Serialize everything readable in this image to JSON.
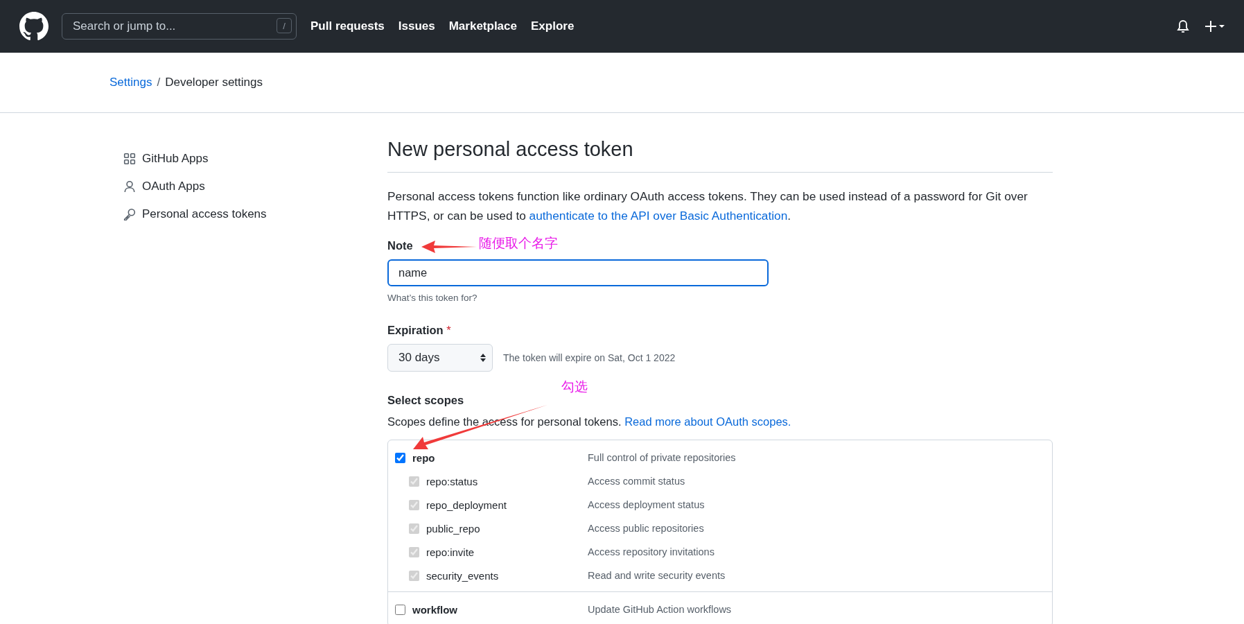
{
  "header": {
    "search": {
      "placeholder": "Search or jump to...",
      "key": "/"
    },
    "nav": [
      "Pull requests",
      "Issues",
      "Marketplace",
      "Explore"
    ]
  },
  "breadcrumb": {
    "items": [
      {
        "label": "Settings",
        "kind": "link"
      },
      {
        "label": "Developer settings",
        "kind": "current"
      }
    ],
    "separator": "/"
  },
  "sidebar": {
    "items": [
      {
        "label": "GitHub Apps"
      },
      {
        "label": "OAuth Apps"
      },
      {
        "label": "Personal access tokens"
      }
    ]
  },
  "main": {
    "title": "New personal access token",
    "intro": {
      "text": "Personal access tokens function like ordinary OAuth access tokens. They can be used instead of a password for Git over HTTPS, or can be used to ",
      "link": "authenticate to the API over Basic Authentication",
      "end": "."
    },
    "note": {
      "label": "Note",
      "value": "name",
      "hint": "What’s this token for?"
    },
    "expiration": {
      "label": "Expiration",
      "required": "*",
      "value": "30 days",
      "info": "The token will expire on Sat, Oct 1 2022"
    },
    "scopes": {
      "label": "Select scopes",
      "text": "Scopes define the access for personal tokens. ",
      "link": "Read more about OAuth scopes.",
      "items": [
        {
          "name": "repo",
          "description": "Full control of private repositories",
          "checked": true,
          "disabled": false,
          "children": [
            {
              "name": "repo:status",
              "description": "Access commit status",
              "checked": true,
              "disabled": true
            },
            {
              "name": "repo_deployment",
              "description": "Access deployment status",
              "checked": true,
              "disabled": true
            },
            {
              "name": "public_repo",
              "description": "Access public repositories",
              "checked": true,
              "disabled": true
            },
            {
              "name": "repo:invite",
              "description": "Access repository invitations",
              "checked": true,
              "disabled": true
            },
            {
              "name": "security_events",
              "description": "Read and write security events",
              "checked": true,
              "disabled": true
            }
          ]
        },
        {
          "name": "workflow",
          "description": "Update GitHub Action workflows",
          "checked": false,
          "disabled": false
        }
      ]
    }
  },
  "annotations": [
    {
      "text": "随便取个名字"
    },
    {
      "text": "勾选"
    }
  ]
}
